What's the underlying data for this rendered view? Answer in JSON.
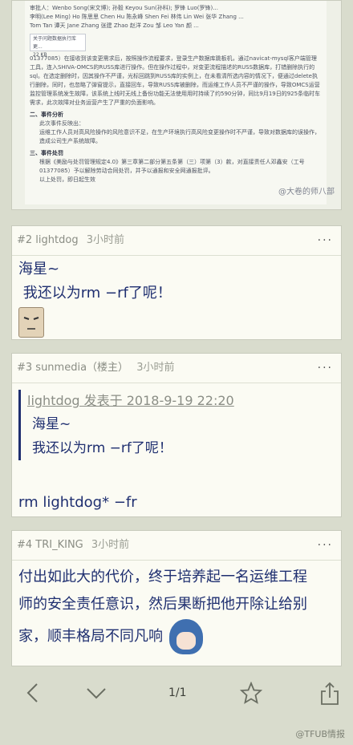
{
  "screenshot": {
    "doc_lines": [
      "审批人：Wenbo Song(宋文博); 孙毅 Keyou Sun(孙科); 罗锋 Luo(罗锋)...",
      "李明(Lee Ming) Ho 陈思思 Chen Hu 陈永峰 Shen Fei 林伟 Lin Wei 张华 Zhang ...",
      "Tom Tan 谭天 Jane Zhang 张建 Zhao 赵洋 Zou 邹 Leo Yan 颜 ..."
    ],
    "file_name": "关于问题数据执行库更...",
    "file_size": "22 KB",
    "para1": "01377085）在接收到该变更需求后，按照操作流程要求，登录生产数据库跳板机，通过navicat-mysql客户端管理工具，连入SHIVA-OMCS的RUSS库进行操作。但在操作过程中，对变更流程描述的RUSS数据库，打错删除执行的sql。在选定删除时，因其操作不严谨，光标回跳到RUSS库的实例上，在未看清所选内容的情况下，便通过delete执行删除，同时，也忽略了弹窗提示，直接回车，导致RUSS库被删除，而运维工作人员不严谨的操作，导致OMCS运营监控管理系统发生故障，该系统上线时无线上备份功能无法使用用时持续了约590分钟，同比9月19日的925条临时车需求，此次故障对业务运营产生了严重的负面影响。",
    "h2": "二、事件分析",
    "p2a": "此次事件反映出：",
    "p2b": "运维工作人员对高风险操作的风险意识不足，在生产环境执行高风险变更操作时不严谨，导致对数据库的误操作，造成公司生产系统故障。",
    "h3": "三、事件处罚",
    "p3": "根据《美励与处罚管理规定4.0》第三章第二部分第五条第（三）项第（3）款，对直接责任人邓鑫安（工号01377085）予以解除劳动合同处罚，并予以通报和安全网通报批评。",
    "p4": "以上处罚，即日起生效",
    "watermark": "@大卷的师八部"
  },
  "posts": [
    {
      "author": "#2 lightdog",
      "time": "3小时前",
      "lines": [
        "海星~",
        " 我还以为rm −rf了呢！"
      ]
    },
    {
      "author": "#3 sunmedia（楼主）",
      "time": "3小时前",
      "quote_head": "lightdog 发表于 2018-9-19 22:20",
      "quote_lines": [
        "海星~",
        "我还以为rm −rf了呢！"
      ],
      "reply": "rm lightdog* −fr"
    },
    {
      "author": "#4 TRI_KING",
      "time": "3小时前",
      "lines": [
        "付出如此大的代价，终于培养起一名运维工程",
        "师的安全责任意识，然后果断把他开除让给别",
        "家，顺丰格局不同凡响"
      ]
    }
  ],
  "more_label": "···",
  "toolbar": {
    "page": "1/1",
    "icons": [
      "back-icon",
      "chevron-down-icon",
      "star-icon",
      "share-icon"
    ]
  },
  "footer_mark": "@TFUB情报",
  "colors": {
    "background": "#d9dccd",
    "card": "#fbfbf3",
    "text": "#1f2f70"
  }
}
